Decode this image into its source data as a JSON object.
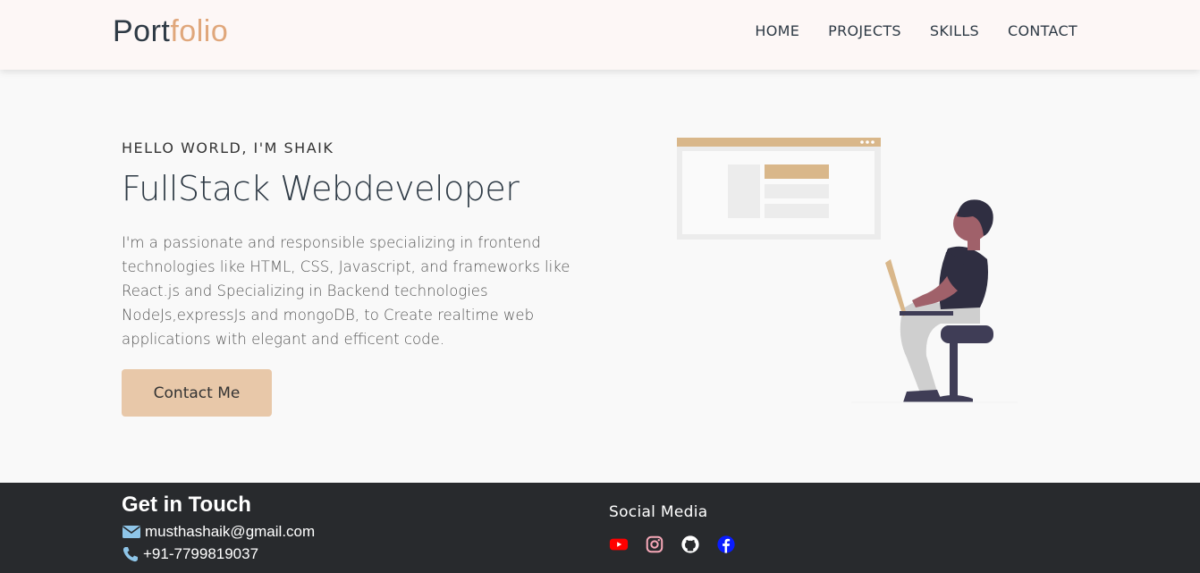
{
  "nav": {
    "brand_main": "Port",
    "brand_accent": "folio",
    "links": [
      "HOME",
      "PROJECTS",
      "SKILLS",
      "CONTACT"
    ]
  },
  "hero": {
    "greeting": "HELLO WORLD, I'M SHAIK",
    "headline": "FullStack Webdeveloper",
    "bio": "I'm a passionate and responsible specializing in frontend technologies like HTML, CSS, Javascript, and frameworks like React.js and Specializing in Backend technologies NodeJs,expressJs and mongoDB, to Create realtime web applications with elegant and efficent code.",
    "cta_label": "Contact Me"
  },
  "footer": {
    "title": "Get in Touch",
    "email": "musthashaik@gmail.com",
    "phone": "+91-7799819037",
    "social_title": "Social Media",
    "social_icons": [
      "youtube-icon",
      "instagram-icon",
      "github-icon",
      "facebook-icon"
    ]
  },
  "colors": {
    "accent": "#e0a77b",
    "button": "#e8c8a9",
    "footer_bg": "#282a2d",
    "youtube": "#ff0000",
    "instagram": "#f7a8b8",
    "facebook": "#0a1cff"
  }
}
